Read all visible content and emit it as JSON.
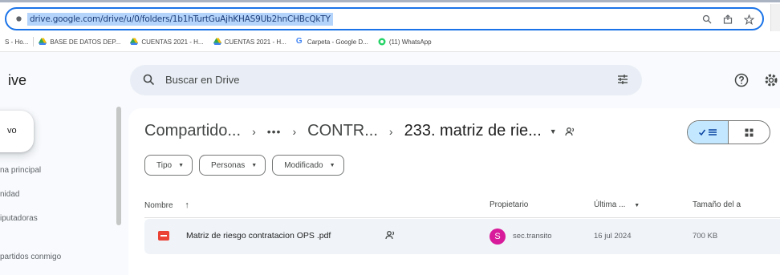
{
  "browser": {
    "url": "drive.google.com/drive/u/0/folders/1b1hTurtGuAjhKHAS9Ub2hnCHBcQkTY",
    "bookmarks": [
      {
        "label": "S - Ho...",
        "icon": "generic-bookmark-icon"
      },
      {
        "label": "BASE DE DATOS DEP...",
        "icon": "google-drive-icon"
      },
      {
        "label": "CUENTAS 2021 - H...",
        "icon": "google-drive-icon"
      },
      {
        "label": "CUENTAS 2021 - H...",
        "icon": "google-drive-icon"
      },
      {
        "label": "Carpeta - Google D...",
        "icon": "google-icon"
      },
      {
        "label": "(11) WhatsApp",
        "icon": "whatsapp-icon"
      }
    ]
  },
  "app": {
    "brand": "ive",
    "search_placeholder": "Buscar en Drive"
  },
  "sidebar": {
    "new_label": "vo",
    "items": [
      {
        "label": "na principal"
      },
      {
        "label": "nidad"
      },
      {
        "label": "iputadoras"
      },
      {
        "label": "partidos conmigo"
      }
    ]
  },
  "breadcrumb": {
    "root": "Compartido...",
    "ellipsis": "•••",
    "middle": "CONTR...",
    "current": "233. matriz de rie..."
  },
  "filters": [
    {
      "label": "Tipo"
    },
    {
      "label": "Personas"
    },
    {
      "label": "Modificado"
    }
  ],
  "columns": {
    "name": "Nombre",
    "owner": "Propietario",
    "modified": "Última ...",
    "size": "Tamaño del a"
  },
  "files": [
    {
      "name": "Matriz de riesgo contratacion OPS .pdf",
      "owner_initial": "S",
      "owner": "sec.transito",
      "modified": "16 jul 2024",
      "size": "700 KB"
    }
  ],
  "colors": {
    "accent": "#1a73e8",
    "search_bg": "#e9eef6",
    "toggle_active": "#c2e7ff",
    "pdf_red": "#ea4335",
    "avatar_pink": "#d81b9a",
    "row_highlight": "#f0f4f9"
  }
}
